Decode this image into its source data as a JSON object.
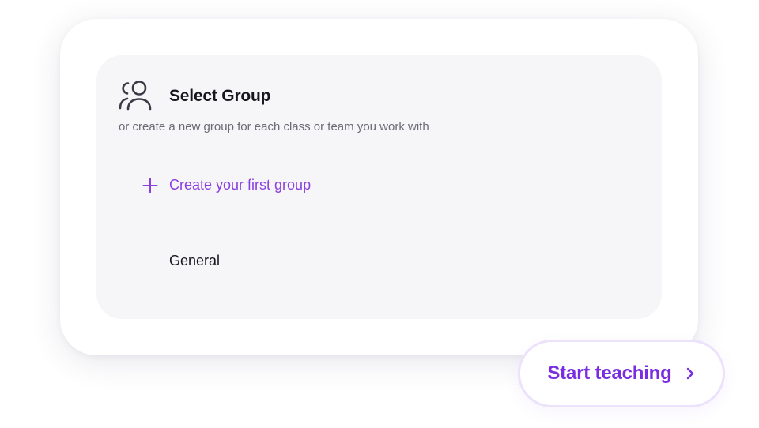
{
  "group_panel": {
    "title": "Select Group",
    "subtitle": "or create a new group for each class or team you work with",
    "icon": "people-group-icon",
    "create_label": "Create your first group",
    "groups": [
      {
        "label": "General"
      }
    ]
  },
  "start_button": {
    "label": "Start teaching",
    "icon": "chevron-right-icon"
  },
  "colors": {
    "accent": "#8b3fe0",
    "accent_strong": "#7a2de0",
    "panel_bg": "#f6f5f8",
    "text_primary": "#17161c",
    "text_secondary": "#6b6a75",
    "button_border": "#ece2fb"
  }
}
